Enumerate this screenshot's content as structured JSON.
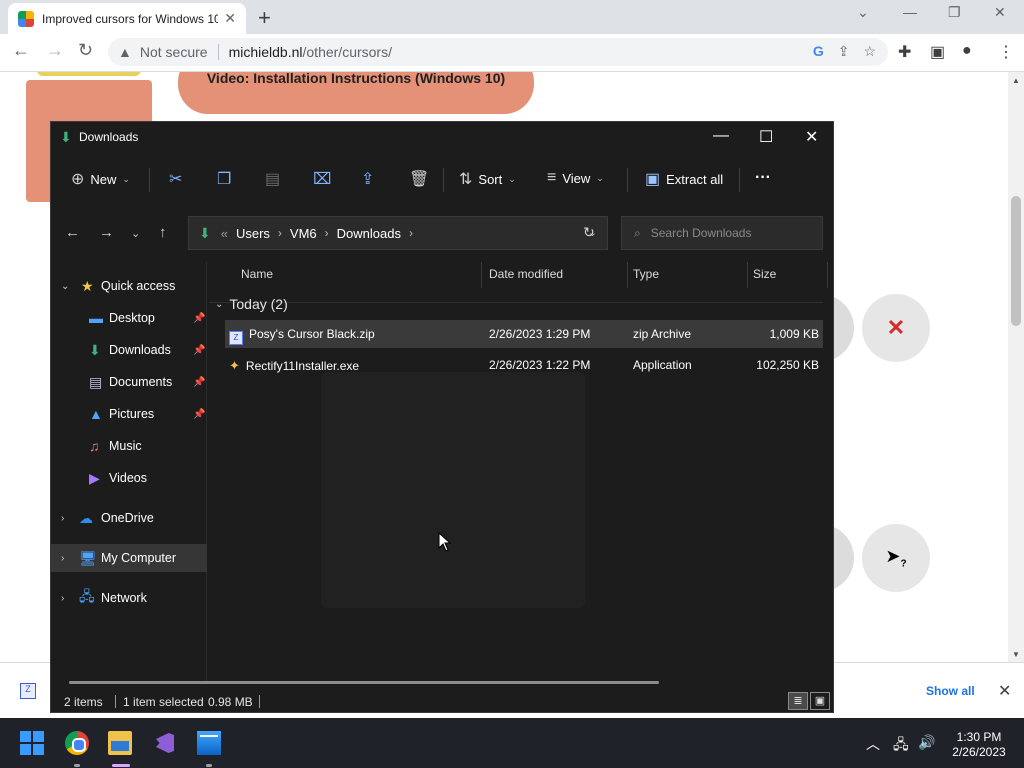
{
  "browser": {
    "tab_title": "Improved cursors for Windows 10",
    "new_tab_glyph": "+",
    "security_label": "Not secure",
    "url_host": "michieldb.nl",
    "url_path": "/other/cursors/"
  },
  "webpage": {
    "video_button": "Video: Installation Instructions (Windows 10)",
    "help_cursor_glyph": "?"
  },
  "download_shelf": {
    "show_all": "Show all"
  },
  "explorer": {
    "title": "Downloads",
    "toolbar": {
      "new": "New",
      "sort": "Sort",
      "view": "View",
      "extract_all": "Extract all",
      "more": "···"
    },
    "breadcrumb": {
      "overflow": "«",
      "items": [
        "Users",
        "VM6",
        "Downloads"
      ]
    },
    "search_placeholder": "Search Downloads",
    "sidebar": {
      "quick_access": "Quick access",
      "items": [
        "Desktop",
        "Downloads",
        "Documents",
        "Pictures",
        "Music",
        "Videos"
      ],
      "onedrive": "OneDrive",
      "my_computer": "My Computer",
      "network": "Network"
    },
    "columns": [
      "Name",
      "Date modified",
      "Type",
      "Size"
    ],
    "group_label": "Today (2)",
    "files": [
      {
        "name": "Posy's Cursor Black.zip",
        "date": "2/26/2023 1:29 PM",
        "type": "zip Archive",
        "size": "1,009 KB",
        "selected": true
      },
      {
        "name": "Rectify11Installer.exe",
        "date": "2/26/2023 1:22 PM",
        "type": "Application",
        "size": "102,250 KB",
        "selected": false
      }
    ],
    "status": {
      "items": "2 items",
      "selection": "1 item selected",
      "size": "0.98 MB"
    }
  },
  "taskbar": {
    "time": "1:30 PM",
    "date": "2/26/2023"
  },
  "colors": {
    "accent_green": "#3fb27f",
    "explorer_bg": "#1c1c1c",
    "page_salmon": "#e59177",
    "link_blue": "#1a73e8"
  }
}
